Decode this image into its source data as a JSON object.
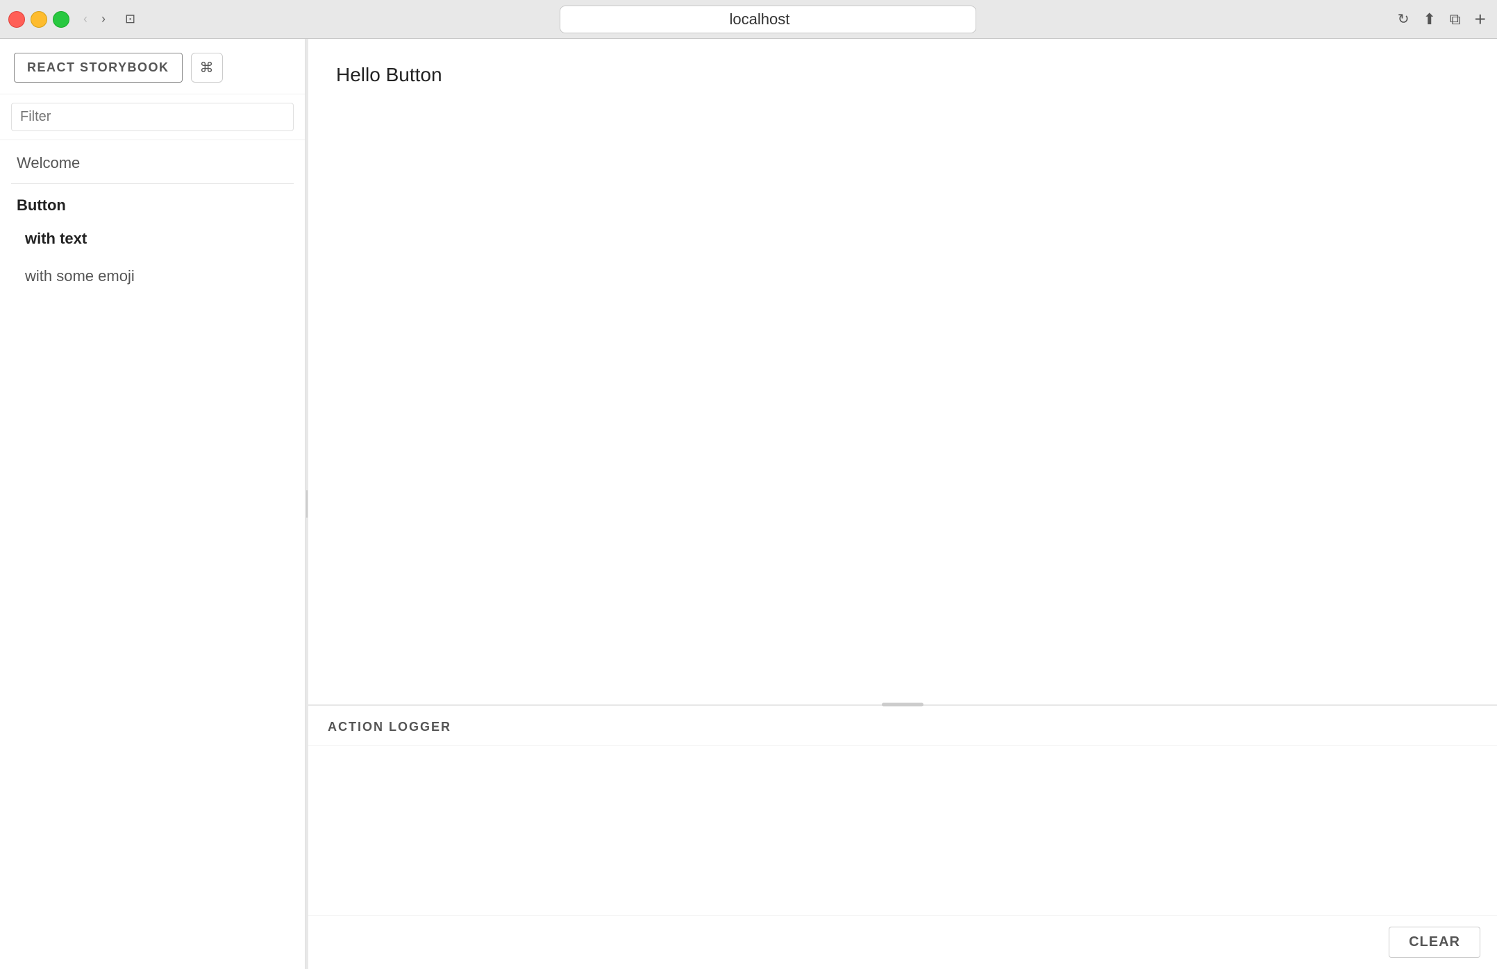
{
  "browser": {
    "address": "localhost",
    "traffic_lights": [
      "red",
      "yellow",
      "green"
    ]
  },
  "sidebar": {
    "storybook_label": "REACT STORYBOOK",
    "filter_placeholder": "Filter",
    "nav_items": [
      {
        "id": "welcome",
        "label": "Welcome",
        "type": "section"
      },
      {
        "id": "button",
        "label": "Button",
        "type": "group"
      },
      {
        "id": "with-text",
        "label": "with text",
        "type": "story",
        "active": true
      },
      {
        "id": "with-some-emoji",
        "label": "with some emoji",
        "type": "story",
        "active": false
      }
    ]
  },
  "story": {
    "title": "Hello Button"
  },
  "action_logger": {
    "header": "ACTION LOGGER",
    "clear_label": "CLEAR"
  }
}
